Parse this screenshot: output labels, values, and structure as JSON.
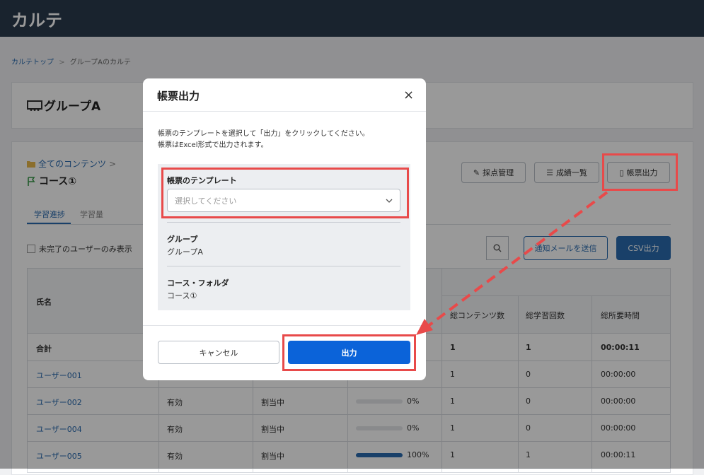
{
  "app": {
    "title": "カルテ"
  },
  "breadcrumb": {
    "home": "カルテトップ",
    "separator": ">",
    "current": "グループAのカルテ"
  },
  "group": {
    "title": "グループA",
    "icon": "group-icon"
  },
  "course": {
    "folder_link": "全てのコンテンツ",
    "folder_chevron": ">",
    "name": "コース①",
    "icon": "flag-icon"
  },
  "toolbar": {
    "grading": "採点管理",
    "grades": "成績一覧",
    "report": "帳票出力"
  },
  "tabs": [
    {
      "label": "学習進捗"
    },
    {
      "label": "学習量"
    }
  ],
  "filters": {
    "incomplete_only": "未完了のユーザーのみ表示"
  },
  "actions": {
    "notify": "通知メールを送信",
    "csv": "CSV出力"
  },
  "table": {
    "columns": {
      "name": "氏名",
      "contents": "総コンテンツ数",
      "sessions": "総学習回数",
      "duration": "総所要時間"
    },
    "total": {
      "label": "合計",
      "contents": "1",
      "sessions": "1",
      "duration": "00:00:11"
    },
    "rows": [
      {
        "name": "ユーザー001",
        "status": "",
        "assign": "",
        "progress": null,
        "progress_text": "",
        "contents": "1",
        "sessions": "0",
        "duration": "00:00:00"
      },
      {
        "name": "ユーザー002",
        "status": "有効",
        "assign": "割当中",
        "progress": 0,
        "progress_text": "0%",
        "contents": "1",
        "sessions": "0",
        "duration": "00:00:00"
      },
      {
        "name": "ユーザー004",
        "status": "有効",
        "assign": "割当中",
        "progress": 0,
        "progress_text": "0%",
        "contents": "1",
        "sessions": "0",
        "duration": "00:00:00"
      },
      {
        "name": "ユーザー005",
        "status": "有効",
        "assign": "割当中",
        "progress": 100,
        "progress_text": "100%",
        "contents": "1",
        "sessions": "1",
        "duration": "00:00:11"
      }
    ]
  },
  "modal": {
    "title": "帳票出力",
    "close": "×",
    "desc_line1": "帳票のテンプレートを選択して「出力」をクリックしてください。",
    "desc_line2": "帳票はExcel形式で出力されます。",
    "template_label": "帳票のテンプレート",
    "template_placeholder": "選択してください",
    "group_label": "グループ",
    "group_value": "グループA",
    "course_label": "コース・フォルダ",
    "course_value": "コース①",
    "cancel": "キャンセル",
    "submit": "出力"
  },
  "colors": {
    "accent": "#2b6cb0",
    "primary_button": "#0b63d9",
    "annotation": "#e84a4a",
    "header": "#2a3b4d"
  }
}
